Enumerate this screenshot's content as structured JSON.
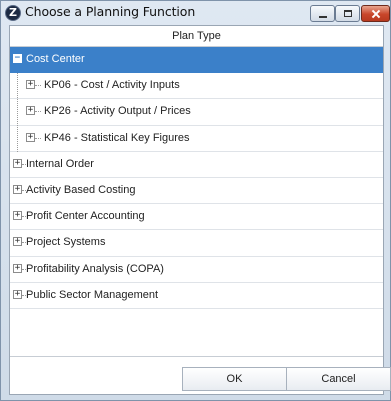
{
  "window": {
    "title": "Choose a Planning Function",
    "app_icon": "app-logo-icon",
    "controls": [
      "minimize-icon",
      "maximize-icon",
      "close-icon"
    ]
  },
  "table": {
    "column_header": "Plan Type"
  },
  "tree": {
    "items": [
      {
        "label": "Cost Center",
        "level": 0,
        "expander": "−",
        "selected": true
      },
      {
        "label": "KP06 - Cost / Activity Inputs",
        "level": 1,
        "expander": "+"
      },
      {
        "label": "KP26 - Activity Output / Prices",
        "level": 1,
        "expander": "+"
      },
      {
        "label": "KP46 - Statistical Key Figures",
        "level": 1,
        "expander": "+"
      },
      {
        "label": "Internal Order",
        "level": 0,
        "expander": "+"
      },
      {
        "label": "Activity Based Costing",
        "level": 0,
        "expander": "+"
      },
      {
        "label": "Profit Center Accounting",
        "level": 0,
        "expander": "+"
      },
      {
        "label": "Project Systems",
        "level": 0,
        "expander": "+"
      },
      {
        "label": "Profitability Analysis (COPA)",
        "level": 0,
        "expander": "+"
      },
      {
        "label": "Public Sector Management",
        "level": 0,
        "expander": "+"
      }
    ]
  },
  "buttons": {
    "ok_label": "OK",
    "cancel_label": "Cancel"
  },
  "colors": {
    "selection": "#3b80c9",
    "close_button": "#c8462b"
  }
}
